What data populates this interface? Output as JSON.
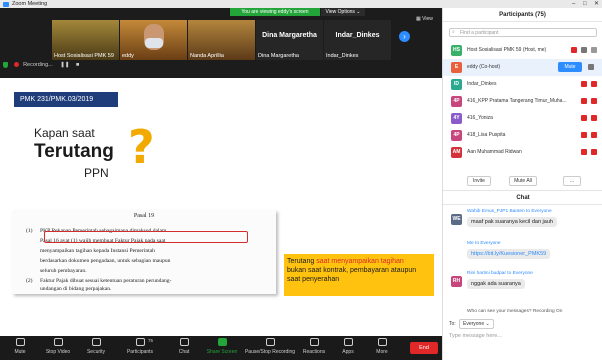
{
  "window": {
    "title": "Zoom Meeting"
  },
  "banner": {
    "viewing": "You are viewing eddy's screen",
    "view_options": "View Options ⌄"
  },
  "view": {
    "label": "View"
  },
  "videos": [
    {
      "name": "Host Sosialisasi PMK 59"
    },
    {
      "name": "eddy"
    },
    {
      "name": "Nanda Aprillia"
    },
    {
      "name": "Dina Margaretha",
      "big": "Dina Margaretha"
    },
    {
      "name": "Indar_Dinkes",
      "big": "Indar_Dinkes"
    }
  ],
  "recording": {
    "label": "Recording..."
  },
  "slide": {
    "header": "PMK 231/PMK.03/2019",
    "kapan": "Kapan saat",
    "terutang": "Terutang",
    "ppn": "PPN",
    "qmark": "?",
    "pasal_title": "Pasal 19",
    "pasal_lines": [
      {
        "n": "(1)",
        "t": "PKP Rekanan Pemerintah sebagaimana dimaksud dalam"
      },
      {
        "n": "",
        "t": "Pasal 16 ayat (1) wajib membuat Faktur Pajak pada saat"
      },
      {
        "n": "",
        "t": "menyampaikan   tagihan   kepada   Instansi   Pemerintah"
      },
      {
        "n": "",
        "t": "berdasarkan dokumen pengadaan, untuk sebagian maupun"
      },
      {
        "n": "",
        "t": "seluruh pembayaran."
      },
      {
        "n": "(2)",
        "t": "Faktur Pajak dibuat sesuai ketentuan peraturan perundang-"
      },
      {
        "n": "",
        "t": "undangan di bidang perpajakan."
      }
    ],
    "callout_a": "Terutang ",
    "callout_b": "saat menyampaikan tagihan",
    "callout_c": "bukan saat kontrak, pembayaran ataupun saat penyerahan"
  },
  "toolbar": {
    "mute": "Mute",
    "stop_video": "Stop Video",
    "security": "Security",
    "participants": "Participants",
    "participants_count": "75",
    "chat": "Chat",
    "share": "Share Screen",
    "record": "Pause/Stop Recording",
    "reactions": "Reactions",
    "apps": "Apps",
    "more": "More",
    "end": "End"
  },
  "participants": {
    "title": "Participants (75)",
    "search_placeholder": "Find a participant",
    "list": [
      {
        "initials": "HS",
        "color": "#3bb06a",
        "name": "Host Sosialisasi PMK 59 (Host, me)"
      },
      {
        "initials": "E",
        "color": "#e8613c",
        "name": "eddy (Co-host)",
        "mute": "Mute"
      },
      {
        "initials": "ID",
        "color": "#2aa98f",
        "name": "Indar_Dinkes"
      },
      {
        "initials": "4P",
        "color": "#c8467e",
        "name": "416_KPP Pratama Tangerang Timur_Muha..."
      },
      {
        "initials": "4Y",
        "color": "#8b5cc9",
        "name": "416_Yoniza"
      },
      {
        "initials": "4P",
        "color": "#c8467e",
        "name": "418_Lisa Puspita"
      },
      {
        "initials": "AM",
        "color": "#d3323a",
        "name": "Aan Muhammad Ridwan"
      }
    ],
    "invite": "Invite",
    "mute_all": "Mute All",
    "more": "..."
  },
  "chat": {
    "title": "Chat",
    "messages": [
      {
        "initials": "WE",
        "color": "#5a6b86",
        "from": "Wahib Emus_PJP1 Banten to Everyone",
        "text": "maaf pak suaranya kecil dan jauh"
      },
      {
        "initials": "",
        "color": "#ffffff",
        "from": "Me to Everyone",
        "text": "https://bit.ly/Kuesioner_PMK59",
        "link": true
      },
      {
        "initials": "RH",
        "color": "#c8467e",
        "from": "Rini hartini budpar to Everyone",
        "text": "nggak ada suaranya"
      }
    ],
    "privacy_note": "Who can see your messages? Recording On",
    "to_label": "To:",
    "recipient": "Everyone ⌄",
    "placeholder": "Type message here..."
  }
}
